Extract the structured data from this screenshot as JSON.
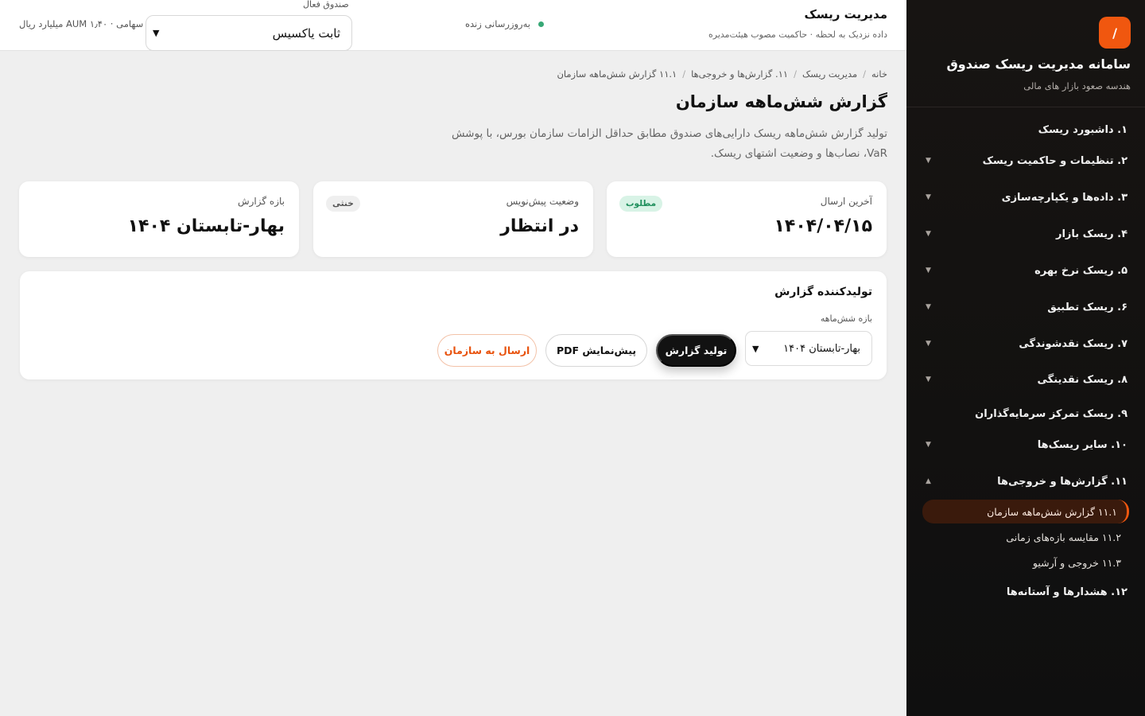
{
  "sidebar": {
    "logo": "/",
    "title": "سامانه مدیریت ریسک صندوق",
    "subtitle": "هندسه صعود بازار های مالی",
    "items": [
      {
        "label": "۱. داشبورد ریسک",
        "chevron": ""
      },
      {
        "label": "۲. تنظیمات و حاکمیت ریسک",
        "chevron": "▼"
      },
      {
        "label": "۳. داده‌ها و یکپارچه‌سازی",
        "chevron": "▼"
      },
      {
        "label": "۴. ریسک بازار",
        "chevron": "▼"
      },
      {
        "label": "۵. ریسک نرخ بهره",
        "chevron": "▼"
      },
      {
        "label": "۶. ریسک تطبیق",
        "chevron": "▼"
      },
      {
        "label": "۷. ریسک نقدشوندگی",
        "chevron": "▼"
      },
      {
        "label": "۸. ریسک نقدینگی",
        "chevron": "▼"
      },
      {
        "label": "۹. ریسک تمرکز سرمایه‌گذاران",
        "chevron": ""
      },
      {
        "label": "۱۰. سایر ریسک‌ها",
        "chevron": "▼"
      },
      {
        "label": "۱۱. گزارش‌ها و خروجی‌ها",
        "chevron": "▲"
      },
      {
        "label": "۱۲. هشدارها و آستانه‌ها",
        "chevron": ""
      }
    ],
    "subitems": [
      {
        "label": "۱۱.۱ گزارش شش‌ماهه سازمان"
      },
      {
        "label": "۱۱.۲ مقایسه بازه‌های زمانی"
      },
      {
        "label": "۱۱.۳ خروجی و آرشیو"
      }
    ]
  },
  "topbar": {
    "title": "مدیریت ریسک",
    "subtitle": "داده نزدیک به لحظه · حاکمیت مصوب هیئت‌مدیره",
    "live_label": "به‌روزرسانی زنده",
    "fund_label": "صندوق فعال",
    "fund_value": "ثابت یاکسیس",
    "aum": "سهامی · AUM ۱٫۴۰ میلیارد ریال"
  },
  "breadcrumb": [
    "خانه",
    "مدیریت ریسک",
    "۱۱. گزارش‌ها و خروجی‌ها",
    "۱۱.۱ گزارش شش‌ماهه سازمان"
  ],
  "page": {
    "title": "گزارش شش‌ماهه سازمان",
    "description": "تولید گزارش شش‌ماهه ریسک دارایی‌های صندوق مطابق حداقل الزامات سازمان بورس، با پوشش VaR، نصاب‌ها و وضعیت اشتهای ریسک."
  },
  "stats": [
    {
      "label": "آخرین ارسال",
      "value": "۱۴۰۴/۰۴/۱۵",
      "badge": "مطلوب",
      "badge_color": "#1f8f5c"
    },
    {
      "label": "وضعیت پیش‌نویس",
      "value": "در انتظار",
      "badge": "خنثی",
      "badge_color": "#555555"
    },
    {
      "label": "بازه گزارش",
      "value": "بهار-تابستان ۱۴۰۴",
      "badge": ""
    }
  ],
  "generator": {
    "title": "تولیدکننده گزارش",
    "period_label": "بازه شش‌ماهه",
    "period_value": "بهار-تابستان ۱۴۰۴",
    "generate_label": "تولید گزارش",
    "preview_label": "پیش‌نمایش PDF",
    "submit_label": "ارسال به سازمان"
  },
  "colors": {
    "accent": "#f0570f",
    "sidebar_bg": "#121212",
    "live": "#38a876"
  }
}
